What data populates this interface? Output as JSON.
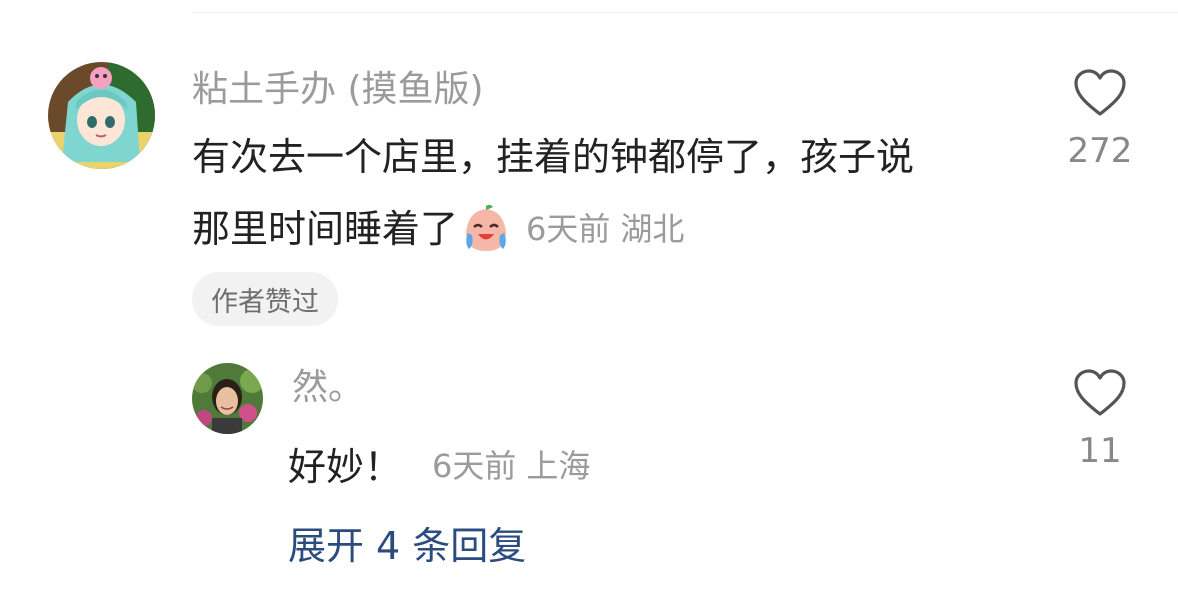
{
  "comment": {
    "username": "粘土手办 (摸鱼版)",
    "text_line1": "有次去一个店里，挂着的钟都停了，孩子说",
    "text_line2": "那里时间睡着了",
    "emoji": "crying-laughing-peach-emoji",
    "time": "6天前",
    "location": "湖北",
    "badge": "作者赞过",
    "like_count": "272",
    "like_icon": "heart-outline-icon"
  },
  "reply": {
    "username": "然。",
    "text": "好妙！",
    "time": "6天前",
    "location": "上海",
    "like_count": "11",
    "like_icon": "heart-outline-icon"
  },
  "expand": {
    "prefix": "展开",
    "count": "4",
    "suffix": "条回复"
  },
  "colors": {
    "text": "#222222",
    "meta": "#9b9b9b",
    "link": "#2b4c7e",
    "badge_bg": "#f2f2f2"
  }
}
